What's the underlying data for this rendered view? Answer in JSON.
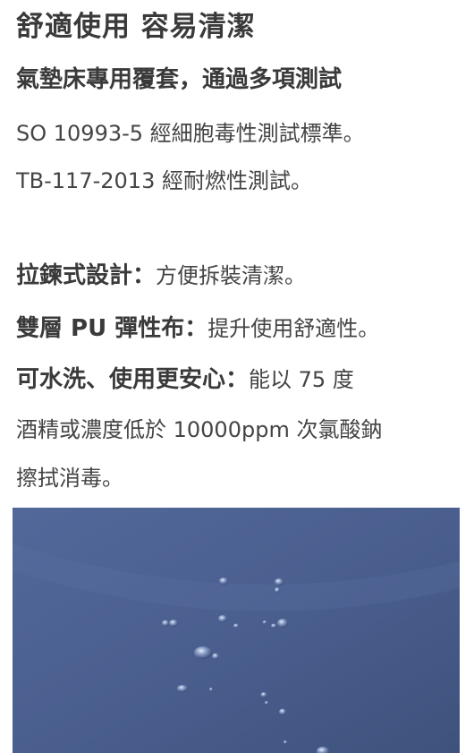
{
  "heading": "舒適使用  容易清潔",
  "subheading": "氣墊床專用覆套，通過多項測試",
  "tests": [
    "SO 10993-5 經細胞毒性測試標準。",
    "TB-117-2013 經耐燃性測試。"
  ],
  "features": [
    {
      "label": "拉鍊式設計：",
      "text": "方便拆裝清潔。"
    },
    {
      "label": "雙層 PU 彈性布：",
      "text": "提升使用舒適性。"
    },
    {
      "label": "可水洗、使用更安心：",
      "text": "能以 75 度"
    }
  ],
  "feature_continued": [
    "酒精或濃度低於 10000ppm 次氯酸鈉",
    "擦拭消毒。"
  ],
  "photo": {
    "subject": "water-droplets-on-blue-fabric",
    "color": "#4a5f8c"
  }
}
